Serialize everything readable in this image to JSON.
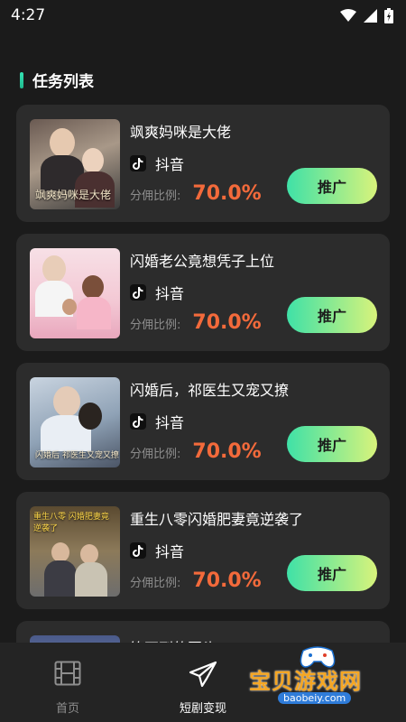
{
  "status_bar": {
    "time": "4:27"
  },
  "section": {
    "title": "任务列表"
  },
  "tasks": [
    {
      "title": "飒爽妈咪是大佬",
      "platform": "抖音",
      "commission_label": "分佣比例:",
      "commission_value": "70.0%",
      "action": "推广",
      "poster_text": "飒爽妈咪是大佬"
    },
    {
      "title": "闪婚老公竟想凭子上位",
      "platform": "抖音",
      "commission_label": "分佣比例:",
      "commission_value": "70.0%",
      "action": "推广",
      "poster_text": ""
    },
    {
      "title": "闪婚后，祁医生又宠又撩",
      "platform": "抖音",
      "commission_label": "分佣比例:",
      "commission_value": "70.0%",
      "action": "推广",
      "poster_text": "闪婚后 祁医生又宠又撩"
    },
    {
      "title": "重生八零闪婚肥妻竟逆袭了",
      "platform": "抖音",
      "commission_label": "分佣比例:",
      "commission_value": "70.0%",
      "action": "推广",
      "poster_text": "重生八零 闪婚肥妻竟逆袭了"
    },
    {
      "title": "等不到的回头"
    }
  ],
  "bottom_nav": {
    "home_label": "首页",
    "drama_label": "短剧变现"
  },
  "watermark": {
    "text": "宝贝游戏网",
    "url": "baobeiy.com"
  },
  "colors": {
    "accent": "#35e3b4",
    "commission": "#f36a3b",
    "button_start": "#3fe1a7",
    "button_end": "#d8f37b"
  }
}
